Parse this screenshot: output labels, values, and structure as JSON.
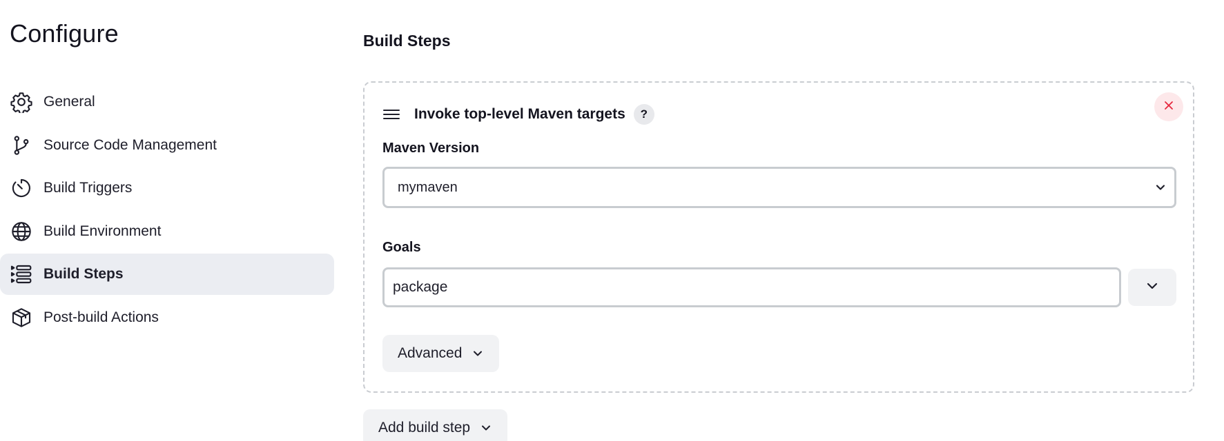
{
  "sidebar": {
    "title": "Configure",
    "items": [
      {
        "label": "General",
        "icon": "gear-icon",
        "active": false
      },
      {
        "label": "Source Code Management",
        "icon": "git-branch-icon",
        "active": false
      },
      {
        "label": "Build Triggers",
        "icon": "timer-icon",
        "active": false
      },
      {
        "label": "Build Environment",
        "icon": "globe-icon",
        "active": false
      },
      {
        "label": "Build Steps",
        "icon": "list-icon",
        "active": true
      },
      {
        "label": "Post-build Actions",
        "icon": "package-icon",
        "active": false
      }
    ]
  },
  "main": {
    "section_title": "Build Steps",
    "step": {
      "title": "Invoke top-level Maven targets",
      "help_label": "?",
      "maven_version_label": "Maven Version",
      "maven_version_value": "mymaven",
      "goals_label": "Goals",
      "goals_value": "package",
      "advanced_label": "Advanced"
    },
    "add_build_step_label": "Add build step"
  },
  "colors": {
    "active_nav_bg": "#ebedf2",
    "close_button_bg": "#fde8ea",
    "close_icon": "#e6273e",
    "card_border": "#c9ccd1"
  }
}
